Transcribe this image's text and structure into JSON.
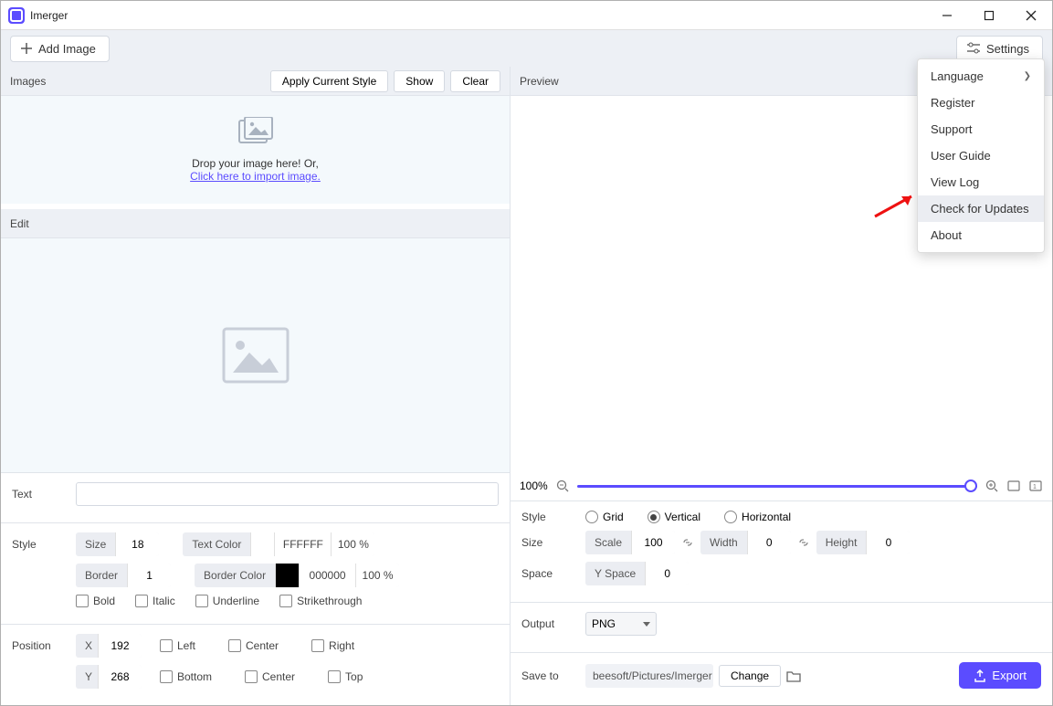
{
  "app": {
    "title": "Imerger"
  },
  "toolbar": {
    "add_image": "Add Image",
    "settings": "Settings"
  },
  "images_panel": {
    "title": "Images",
    "apply": "Apply Current Style",
    "show": "Show",
    "clear": "Clear",
    "drop_line1": "Drop your image here! Or,",
    "drop_link": "Click here to import image."
  },
  "edit_panel": {
    "title": "Edit"
  },
  "text_section": {
    "label": "Text",
    "value": ""
  },
  "style_section": {
    "label": "Style",
    "size_label": "Size",
    "size": "18",
    "text_color_label": "Text Color",
    "text_color_hex": "FFFFFF",
    "text_color_pct": "100 %",
    "border_label": "Border",
    "border": "1",
    "border_color_label": "Border Color",
    "border_color_hex": "000000",
    "border_color_pct": "100 %",
    "bold": "Bold",
    "italic": "Italic",
    "underline": "Underline",
    "strike": "Strikethrough"
  },
  "position_section": {
    "label": "Position",
    "x_label": "X",
    "x": "192",
    "y_label": "Y",
    "y": "268",
    "left": "Left",
    "center": "Center",
    "right": "Right",
    "bottom": "Bottom",
    "top": "Top"
  },
  "preview": {
    "title": "Preview"
  },
  "zoom": {
    "pct": "100%"
  },
  "pstyle": {
    "label": "Style",
    "grid": "Grid",
    "vertical": "Vertical",
    "horizontal": "Horizontal",
    "selected": "vertical"
  },
  "psize": {
    "label": "Size",
    "scale_label": "Scale",
    "scale": "100",
    "width_label": "Width",
    "width": "0",
    "height_label": "Height",
    "height": "0"
  },
  "pspace": {
    "label": "Space",
    "yspace_label": "Y Space",
    "yspace": "0"
  },
  "output": {
    "label": "Output",
    "format": "PNG"
  },
  "saveto": {
    "label": "Save to",
    "path": "beesoft/Pictures/Imerger",
    "change": "Change"
  },
  "export": {
    "label": "Export"
  },
  "menu": {
    "language": "Language",
    "register": "Register",
    "support": "Support",
    "user_guide": "User Guide",
    "view_log": "View Log",
    "check_updates": "Check for Updates",
    "about": "About"
  }
}
